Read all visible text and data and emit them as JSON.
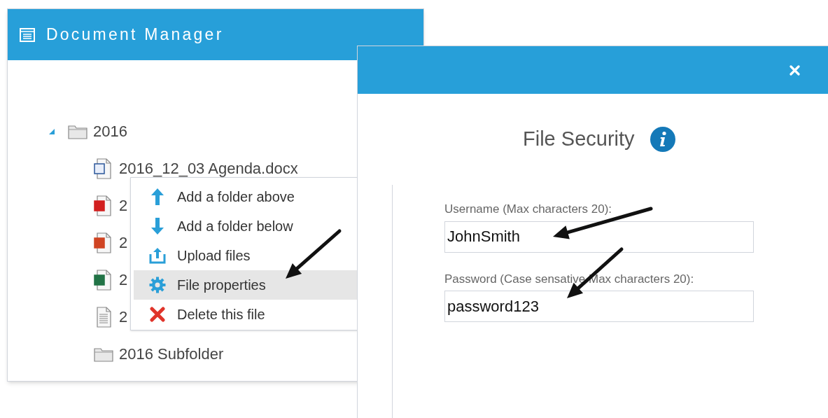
{
  "panel": {
    "title": "Document Manager",
    "tree": [
      {
        "label": "2016",
        "kind": "folder",
        "expanded": true,
        "children": [
          {
            "label": "2016_12_03 Agenda.docx",
            "kind": "word"
          },
          {
            "label": "2",
            "kind": "pdf"
          },
          {
            "label": "2",
            "kind": "powerpoint"
          },
          {
            "label": "2",
            "kind": "excel"
          },
          {
            "label": "2",
            "kind": "text"
          },
          {
            "label": "2016 Subfolder",
            "kind": "folder"
          }
        ]
      }
    ]
  },
  "context_menu": [
    {
      "label": "Add a folder above",
      "kind": "up",
      "selected": false
    },
    {
      "label": "Add a folder below",
      "kind": "down",
      "selected": false
    },
    {
      "label": "Upload files",
      "kind": "upload",
      "selected": false
    },
    {
      "label": "File properties",
      "kind": "gear",
      "selected": true
    },
    {
      "label": "Delete this file",
      "kind": "delete",
      "selected": false
    }
  ],
  "dialog": {
    "title": "File Security",
    "fields": [
      {
        "label": "Username (Max characters 20):",
        "value": "JohnSmith"
      },
      {
        "label": "Password (Case sensative Max characters 20):",
        "value": "password123"
      }
    ]
  }
}
